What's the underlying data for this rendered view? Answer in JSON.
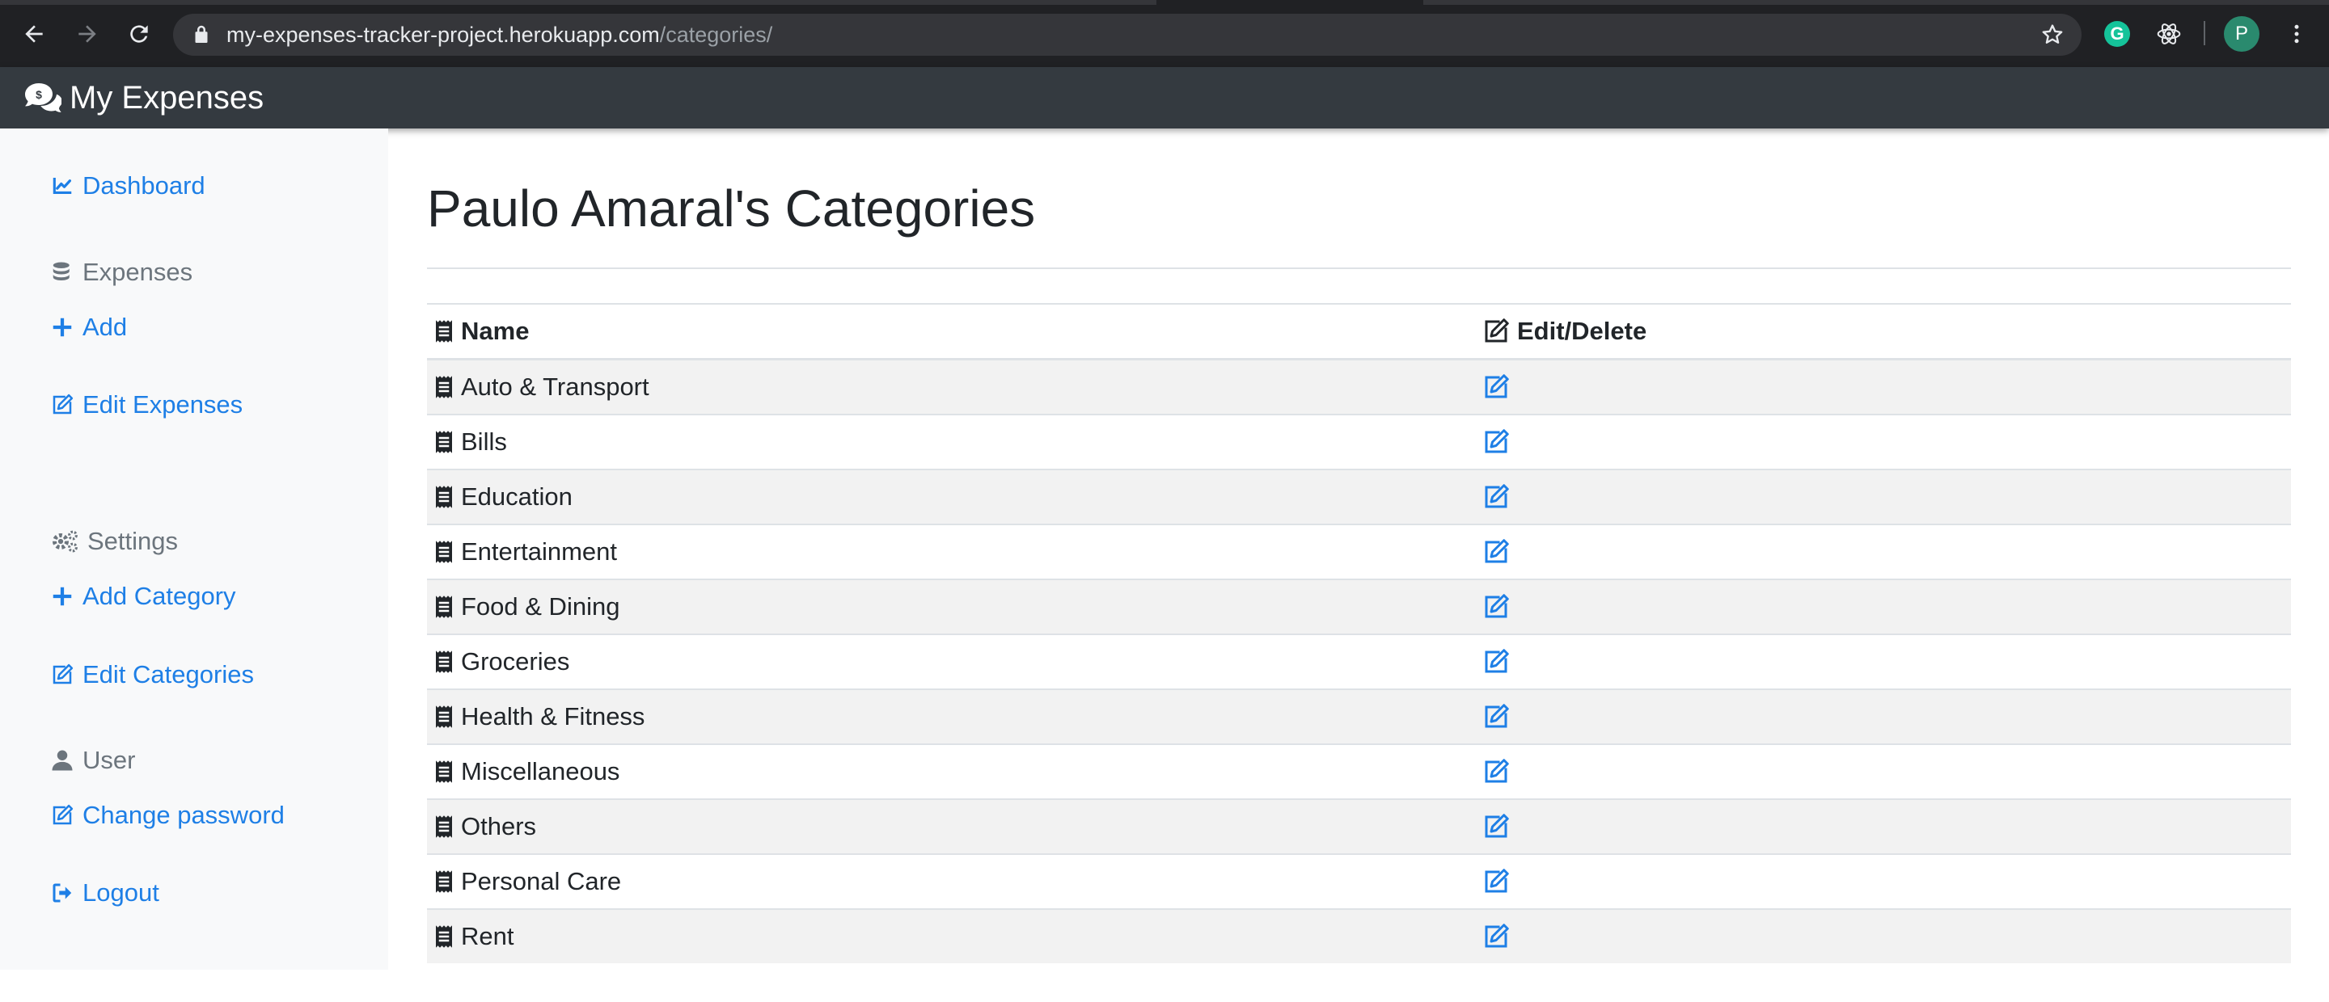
{
  "browser": {
    "url_host": "my-expenses-tracker-project.herokuapp.com",
    "url_path": "/categories/",
    "profile_initial": "P",
    "extension_initial": "G"
  },
  "navbar": {
    "brand_label": "My Expenses",
    "brand_icon": "comments-dollar-icon",
    "background": "#343a40"
  },
  "sidebar": {
    "dashboard": "Dashboard",
    "expenses_heading": "Expenses",
    "add": "Add",
    "edit_expenses": "Edit Expenses",
    "settings_heading": "Settings",
    "add_category": "Add Category",
    "edit_categories": "Edit Categories",
    "user_heading": "User",
    "change_password": "Change password",
    "logout": "Logout",
    "link_color": "#1e7fe6"
  },
  "main": {
    "title": "Paulo Amaral's Categories",
    "table": {
      "headers": [
        "Name",
        "Edit/Delete"
      ],
      "rows": [
        "Auto & Transport",
        "Bills",
        "Education",
        "Entertainment",
        "Food & Dining",
        "Groceries",
        "Health & Fitness",
        "Miscellaneous",
        "Others",
        "Personal Care",
        "Rent"
      ]
    }
  }
}
